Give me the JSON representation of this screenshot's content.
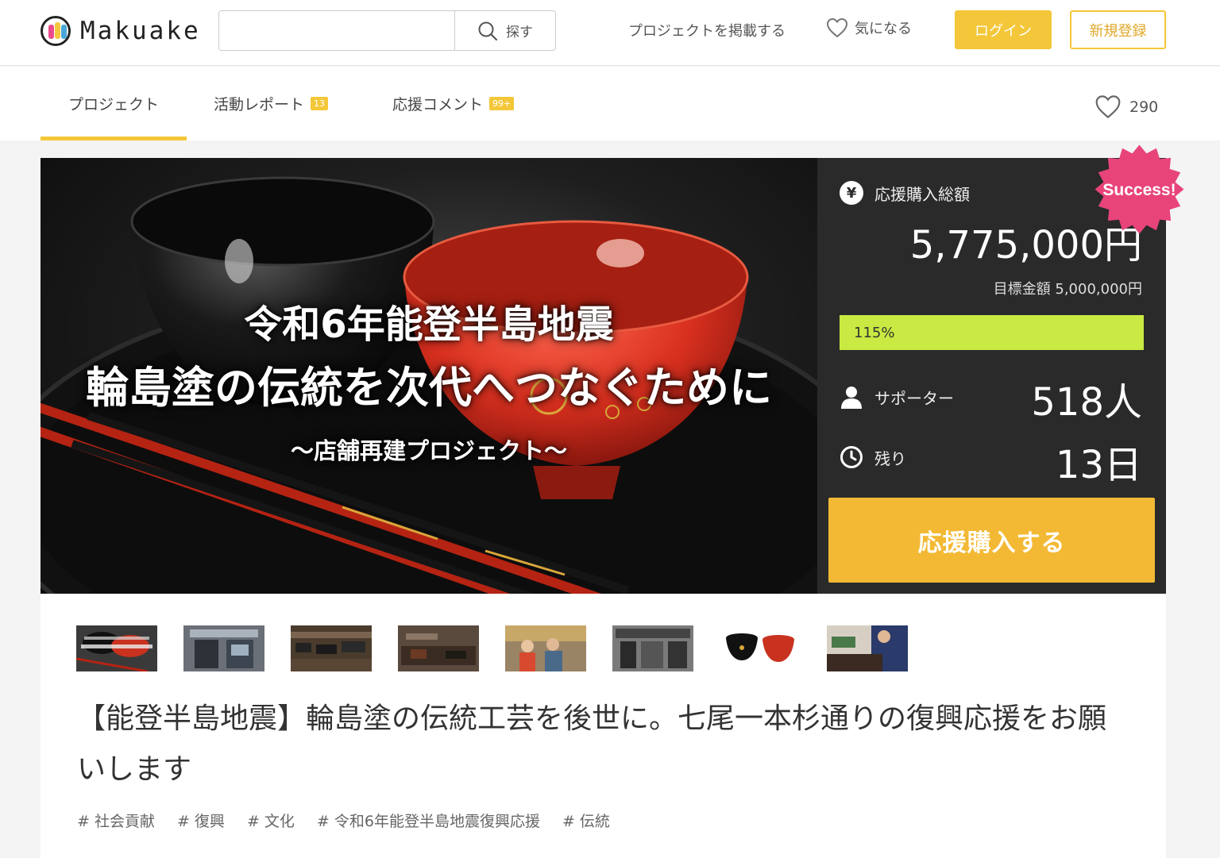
{
  "header": {
    "logo_text": "Makuake",
    "search_placeholder": "",
    "search_button": "探す",
    "post_project": "プロジェクトを掲載する",
    "favorites": "気になる",
    "login": "ログイン",
    "signup": "新規登録"
  },
  "tabs": [
    {
      "label": "プロジェクト",
      "badge": ""
    },
    {
      "label": "活動レポート",
      "badge": "13"
    },
    {
      "label": "応援コメント",
      "badge": "99+"
    }
  ],
  "likes_count": "290",
  "hero": {
    "line1": "令和6年能登半島地震",
    "line2": "輪島塗の伝統を次代へつなぐために",
    "line3": "〜店舗再建プロジェクト〜"
  },
  "stats": {
    "total_label": "応援購入総額",
    "total_amount": "5,775,000円",
    "goal_text": "目標金額 5,000,000円",
    "percent_text": "115%",
    "progress_fraction": 1.0,
    "supporters_label": "サポーター",
    "supporters_value": "518人",
    "remaining_label": "残り",
    "remaining_value": "13日",
    "cta": "応援購入する",
    "success_badge": "Success!"
  },
  "thumbnails": [
    {
      "kind": "title-card"
    },
    {
      "kind": "storefront"
    },
    {
      "kind": "shop-interior"
    },
    {
      "kind": "workshop"
    },
    {
      "kind": "people"
    },
    {
      "kind": "old-photo"
    },
    {
      "kind": "bowls"
    },
    {
      "kind": "craftsman"
    }
  ],
  "project_title": "【能登半島地震】輪島塗の伝統工芸を後世に。七尾一本杉通りの復興応援をお願いします",
  "tags": [
    "# 社会貢献",
    "# 復興",
    "# 文化",
    "# 令和6年能登半島地震復興応援",
    "# 伝統"
  ],
  "colors": {
    "accent_yellow": "#f3c739",
    "cta_orange": "#f3b934",
    "progress_green": "#c9ea42",
    "success_pink": "#e8447a",
    "panel_dark": "#2a2a2a"
  }
}
